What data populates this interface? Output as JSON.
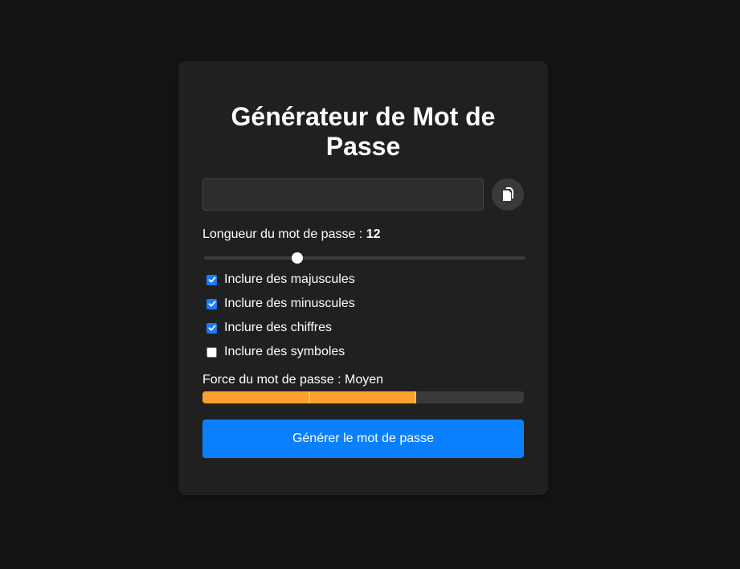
{
  "card": {
    "title": "Générateur de Mot de Passe"
  },
  "password": {
    "value": "",
    "placeholder": "",
    "copy_icon": "copy-icon"
  },
  "length": {
    "label": "Longueur du mot de passe : ",
    "value": "12",
    "slider_fraction": 0.29
  },
  "options": [
    {
      "label": "Inclure des majuscules",
      "checked": true
    },
    {
      "label": "Inclure des minuscules",
      "checked": true
    },
    {
      "label": "Inclure des chiffres",
      "checked": true
    },
    {
      "label": "Inclure des symboles",
      "checked": false
    }
  ],
  "strength": {
    "label": "Force du mot de passe : ",
    "value": "Moyen",
    "fill_fraction": 0.665,
    "color": "#ff9f2e"
  },
  "generate_button": {
    "label": "Générer le mot de passe",
    "color": "#0a80ff"
  }
}
